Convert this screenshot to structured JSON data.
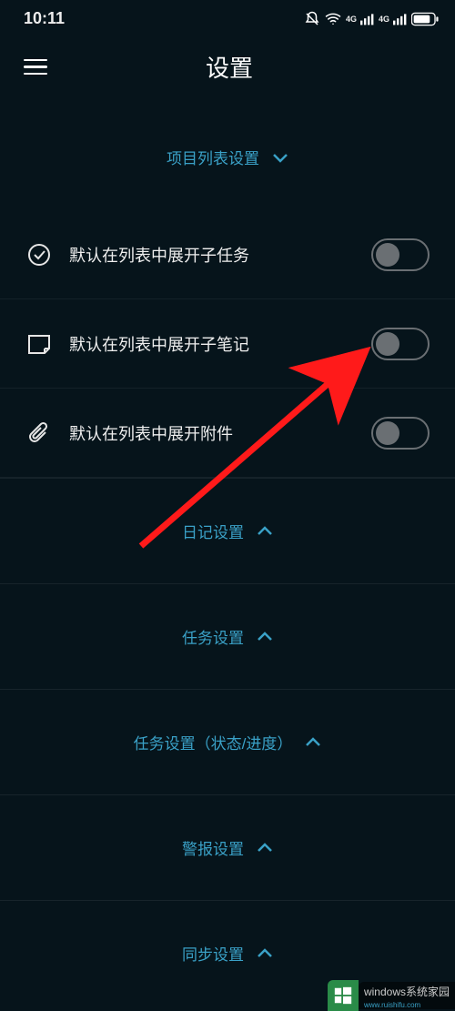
{
  "status": {
    "time": "10:11"
  },
  "header": {
    "title": "设置"
  },
  "section": {
    "title": "项目列表设置"
  },
  "options": [
    {
      "label": "默认在列表中展开子任务",
      "on": false
    },
    {
      "label": "默认在列表中展开子笔记",
      "on": false
    },
    {
      "label": "默认在列表中展开附件",
      "on": false
    }
  ],
  "cats": [
    {
      "label": "日记设置"
    },
    {
      "label": "任务设置"
    },
    {
      "label": "任务设置（状态/进度）"
    },
    {
      "label": "警报设置"
    },
    {
      "label": "同步设置"
    }
  ],
  "watermark": {
    "site": "windows系统家园",
    "url": "www.ruishifu.com"
  }
}
